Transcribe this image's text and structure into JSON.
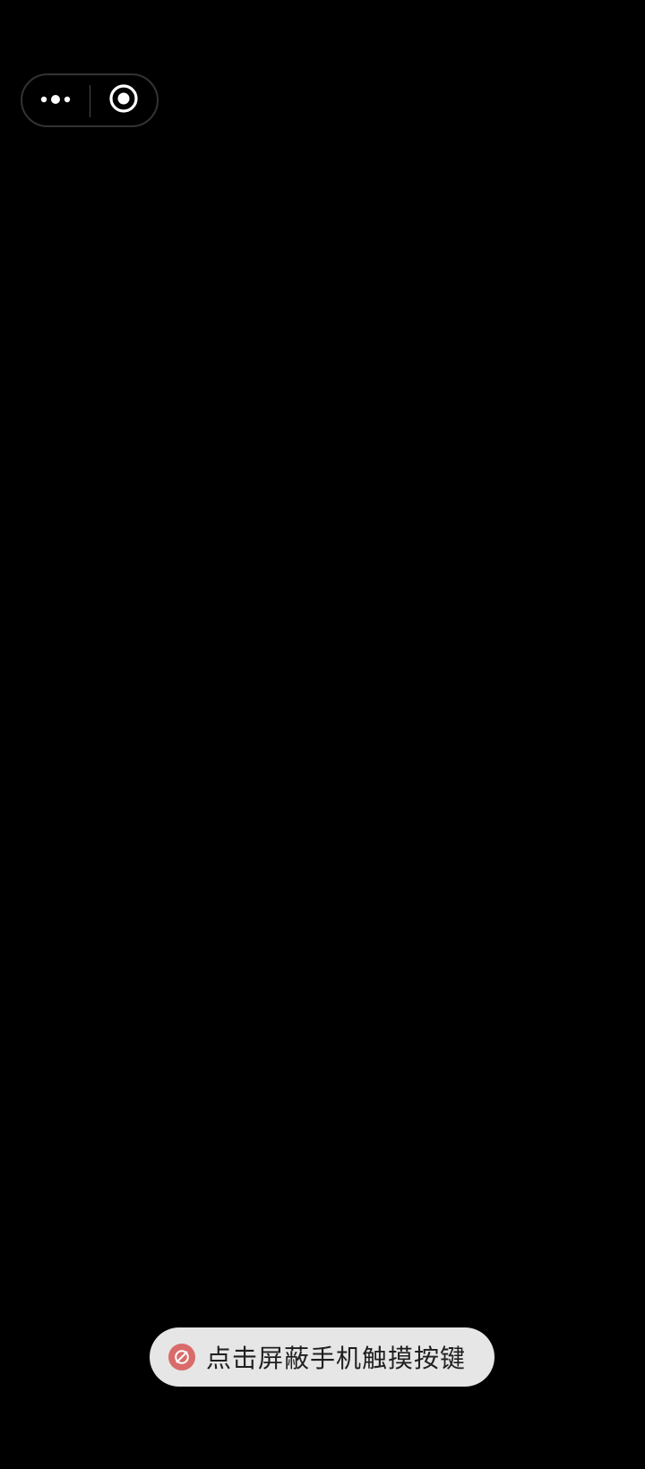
{
  "capsule": {
    "more_icon": "more-dots-icon",
    "close_icon": "target-circle-icon"
  },
  "toast": {
    "icon": "block-icon",
    "icon_color": "#d96b6b",
    "text": "点击屏蔽手机触摸按键"
  },
  "colors": {
    "background": "#000000",
    "capsule_border": "#333333",
    "toast_background": "#e6e6e6"
  }
}
